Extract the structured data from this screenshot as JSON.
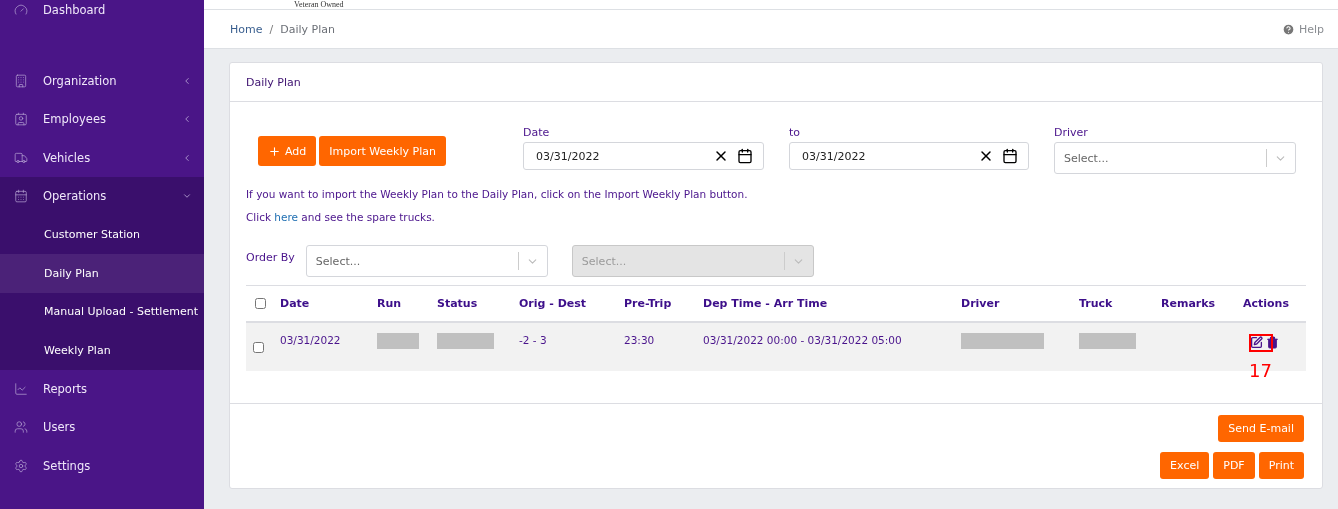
{
  "logo": {
    "caption": "Veteran Owned"
  },
  "sidebar": {
    "items": [
      {
        "label": "Dashboard",
        "kind": "link"
      },
      {
        "label": "Organization",
        "kind": "group",
        "expanded": false
      },
      {
        "label": "Employees",
        "kind": "group",
        "expanded": false
      },
      {
        "label": "Vehicles",
        "kind": "group",
        "expanded": false
      },
      {
        "label": "Operations",
        "kind": "group",
        "expanded": true,
        "children": [
          {
            "label": "Customer Station",
            "selected": false
          },
          {
            "label": "Daily Plan",
            "selected": true
          },
          {
            "label": "Manual Upload - Settlement",
            "selected": false
          },
          {
            "label": "Weekly Plan",
            "selected": false
          }
        ]
      },
      {
        "label": "Reports",
        "kind": "link"
      },
      {
        "label": "Users",
        "kind": "link"
      },
      {
        "label": "Settings",
        "kind": "link"
      }
    ]
  },
  "breadcrumb": [
    {
      "label": "Home",
      "link": true
    },
    {
      "label": "Daily Plan",
      "link": false
    }
  ],
  "breadcrumb_separator": "/",
  "help": "Help",
  "card": {
    "title": "Daily Plan",
    "buttons": [
      {
        "label": "Add",
        "kind": "add"
      },
      {
        "label": "Import Weekly Plan",
        "kind": "plain"
      }
    ],
    "filters": [
      {
        "label": "Date",
        "kind": "date",
        "value": "03/31/2022"
      },
      {
        "label": "to",
        "kind": "date",
        "value": "03/31/2022"
      },
      {
        "label": "Driver",
        "kind": "select",
        "placeholder": "Select..."
      }
    ],
    "hint": "If you want to import the Weekly Plan to the Daily Plan, click on the Import Weekly Plan button.",
    "spare": {
      "before": "Click ",
      "link": "here",
      "after": " and see the spare trucks."
    },
    "order_by": {
      "label": "Order By",
      "selects": [
        {
          "placeholder": "Select...",
          "disabled": false
        },
        {
          "placeholder": "Select...",
          "disabled": true
        }
      ]
    },
    "table": {
      "columns": [
        "Date",
        "Run",
        "Status",
        "Orig - Dest",
        "Pre-Trip",
        "Dep Time - Arr Time",
        "Driver",
        "Truck",
        "Remarks",
        "Actions"
      ],
      "header_checked": false,
      "rows": [
        {
          "checked": false,
          "cells": [
            {
              "text": "03/31/2022",
              "redacted": false
            },
            {
              "redacted": true
            },
            {
              "redacted": true
            },
            {
              "text": "-2 - 3",
              "redacted": false
            },
            {
              "text": "23:30",
              "redacted": false
            },
            {
              "text": "03/31/2022 00:00 - 03/31/2022 05:00",
              "redacted": false
            },
            {
              "redacted": true
            },
            {
              "redacted": true
            }
          ]
        }
      ]
    },
    "annotation": {
      "label": "17"
    },
    "footer_buttons": [
      [
        "Send E-mail"
      ],
      [
        "Excel",
        "PDF",
        "Print"
      ]
    ]
  }
}
